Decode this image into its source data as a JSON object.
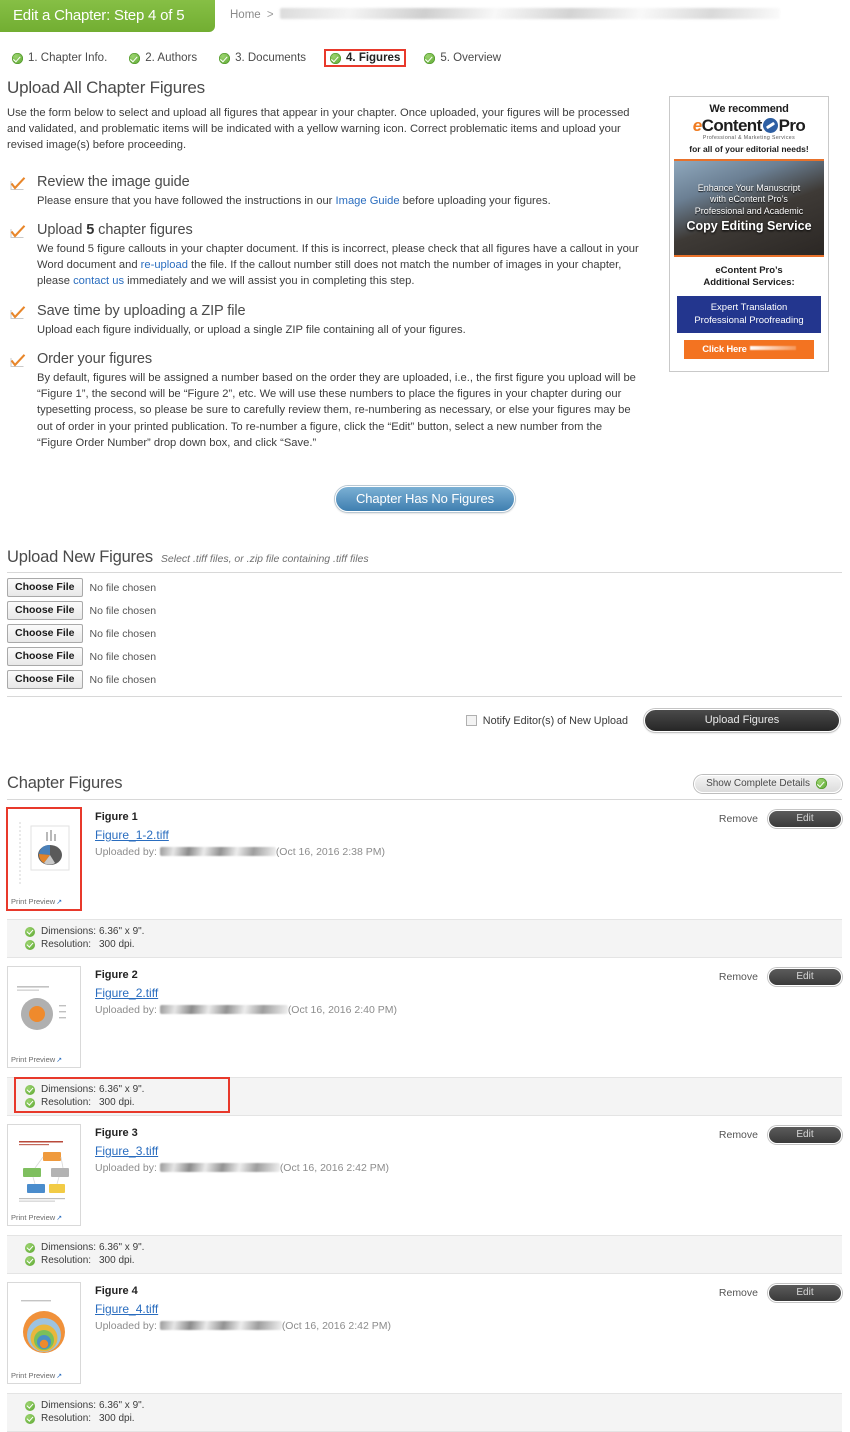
{
  "header": {
    "title": "Edit a Chapter: Step 4 of 5",
    "breadcrumb_home": "Home",
    "breadcrumb_separator": ">",
    "breadcrumb_redacted": ""
  },
  "steps": [
    {
      "label": "1. Chapter Info.",
      "icon": "check-circle-icon",
      "active": false
    },
    {
      "label": "2. Authors",
      "icon": "check-circle-icon",
      "active": false
    },
    {
      "label": "3. Documents",
      "icon": "check-circle-icon",
      "active": false
    },
    {
      "label": "4. Figures",
      "icon": "check-circle-icon",
      "active": true
    },
    {
      "label": "5. Overview",
      "icon": "check-circle-icon",
      "active": false
    }
  ],
  "page_title": "Upload All Chapter Figures",
  "intro": "Use the form below to select and upload all figures that appear in your chapter. Once uploaded, your figures will be processed and validated, and problematic items will be indicated with a yellow warning icon. Correct problematic items and upload your revised image(s) before proceeding.",
  "tips": [
    {
      "icon": "orange-check-icon",
      "head_pre": "Review the image guide",
      "head_bold": "",
      "head_post": "",
      "body_1": "Please ensure that you have followed the instructions in our ",
      "link_1": "Image Guide",
      "body_2": " before uploading your figures.",
      "link_2": "",
      "body_3": ""
    },
    {
      "icon": "orange-check-icon",
      "head_pre": "Upload ",
      "head_bold": "5",
      "head_post": " chapter figures",
      "body_1": "We found 5 figure callouts in your chapter document. If this is incorrect, please check that all figures have a callout in your Word document and ",
      "link_1": "re-upload",
      "body_2": " the file. If the callout number still does not match the number of images in your chapter, please ",
      "link_2": "contact us",
      "body_3": " immediately and we will assist you in completing this step."
    },
    {
      "icon": "orange-check-icon",
      "head_pre": "Save time by uploading a ZIP file",
      "head_bold": "",
      "head_post": "",
      "body_1": "Upload each figure individually, or upload a single ZIP file containing all of your figures.",
      "link_1": "",
      "body_2": "",
      "link_2": "",
      "body_3": ""
    },
    {
      "icon": "orange-check-icon",
      "head_pre": "Order your figures",
      "head_bold": "",
      "head_post": "",
      "body_1": "By default, figures will be assigned a number based on the order they are uploaded, i.e., the first figure you upload will be “Figure 1”, the second will be “Figure 2”, etc. We will use these numbers to place the figures in your chapter during our typesetting process, so please be sure to carefully review them, re-numbering as necessary, or else your figures may be out of order in your printed publication. To re-number a figure, click the “Edit” button, select a new number from the “Figure Order Number” drop down box, and click “Save.”",
      "link_1": "",
      "body_2": "",
      "link_2": "",
      "body_3": ""
    }
  ],
  "ad": {
    "line1": "We recommend",
    "logo_e": "e",
    "logo_content": "Content",
    "logo_pro": "Pro",
    "logo_sub": "Professional & Marketing Services",
    "line2": "for all of your editorial needs!",
    "banner_line1": "Enhance Your Manuscript",
    "banner_line2": "with eContent Pro’s",
    "banner_line3": "Professional and Academic",
    "banner_big": "Copy Editing Service",
    "services_line1": "eContent Pro’s",
    "services_line2": "Additional Services:",
    "blue_line1": "Expert Translation",
    "blue_line2": "Professional Proofreading",
    "cta": "Click Here"
  },
  "no_figures_button": "Chapter Has No Figures",
  "upload": {
    "heading": "Upload New Figures",
    "hint": "Select .tiff files, or .zip file containing .tiff files",
    "choose_label": "Choose File",
    "no_file_label": "No file chosen",
    "rows": 5,
    "notify_label": "Notify Editor(s) of New Upload",
    "notify_checked": false,
    "upload_button": "Upload Figures"
  },
  "chapter_figures": {
    "heading": "Chapter Figures",
    "show_details_label": "Show Complete Details",
    "show_details_icon": "check-circle-icon",
    "remove_label": "Remove",
    "edit_label": "Edit",
    "print_preview_label": "Print Preview",
    "print_preview_icon": "external-link-icon",
    "dimensions_label": "Dimensions:",
    "resolution_label": "Resolution:",
    "figures": [
      {
        "name": "Figure 1",
        "file": "Figure_1-2.tiff",
        "uploaded_by_label": "Uploaded by:",
        "uploader_redacted": true,
        "uploaded_at": "(Oct 16, 2016 2:38 PM)",
        "dimensions": "6.36\" x 9\".",
        "resolution": "300 dpi.",
        "thumb": "chart-pie-bar",
        "thumb_highlighted": true,
        "facts_highlighted": false
      },
      {
        "name": "Figure 2",
        "file": "Figure_2.tiff",
        "uploaded_by_label": "Uploaded by:",
        "uploader_redacted": true,
        "uploaded_at": "(Oct 16, 2016 2:40 PM)",
        "dimensions": "6.36\" x 9\".",
        "resolution": "300 dpi.",
        "thumb": "concentric-circle",
        "thumb_highlighted": false,
        "facts_highlighted": true
      },
      {
        "name": "Figure 3",
        "file": "Figure_3.tiff",
        "uploaded_by_label": "Uploaded by:",
        "uploader_redacted": true,
        "uploaded_at": "(Oct 16, 2016 2:42 PM)",
        "dimensions": "6.36\" x 9\".",
        "resolution": "300 dpi.",
        "thumb": "flow-diagram",
        "thumb_highlighted": false,
        "facts_highlighted": false
      },
      {
        "name": "Figure 4",
        "file": "Figure_4.tiff",
        "uploaded_by_label": "Uploaded by:",
        "uploader_redacted": true,
        "uploaded_at": "(Oct 16, 2016 2:42 PM)",
        "dimensions": "6.36\" x 9\".",
        "resolution": "300 dpi.",
        "thumb": "nested-rings",
        "thumb_highlighted": false,
        "facts_highlighted": false
      }
    ]
  },
  "colors": {
    "brand_green": "#7cb73c",
    "link_blue": "#2a6dbf",
    "highlight_red": "#e8392b",
    "accent_orange": "#f07c22",
    "check_green": "#5aa62f"
  }
}
